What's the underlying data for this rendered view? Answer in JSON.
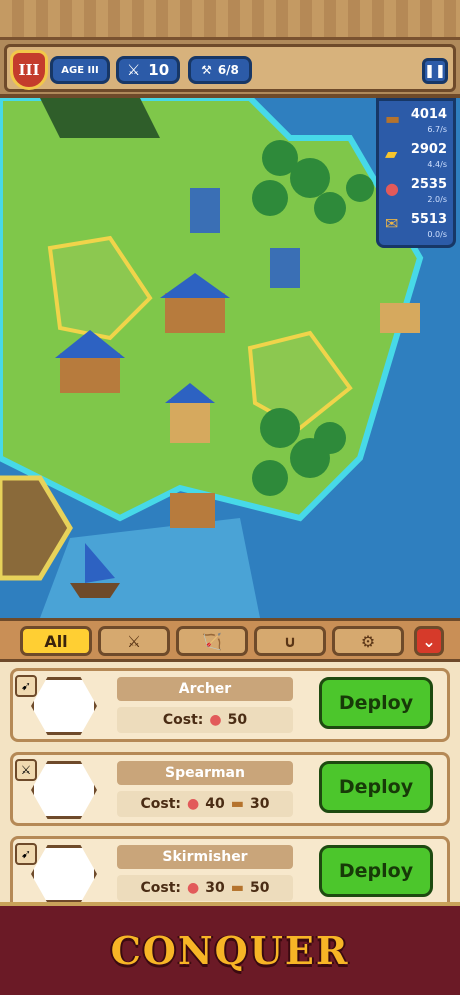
{
  "topbar": {
    "age_roman": "III",
    "age_label": "AGE III",
    "sword_count": "10",
    "workers": "6/8"
  },
  "resources": [
    {
      "icon": "wood-icon",
      "value": "4014",
      "rate": "6.7/s"
    },
    {
      "icon": "gold-icon",
      "value": "2902",
      "rate": "4.4/s"
    },
    {
      "icon": "meat-icon",
      "value": "2535",
      "rate": "2.0/s"
    },
    {
      "icon": "scroll-icon",
      "value": "5513",
      "rate": "0.0/s"
    }
  ],
  "tabs": {
    "all_label": "All"
  },
  "units": [
    {
      "name": "Archer",
      "cost_label": "Cost:",
      "meat": "50",
      "wood": "",
      "deploy": "Deploy"
    },
    {
      "name": "Spearman",
      "cost_label": "Cost:",
      "meat": "40",
      "wood": "30",
      "deploy": "Deploy"
    },
    {
      "name": "Skirmisher",
      "cost_label": "Cost:",
      "meat": "30",
      "wood": "50",
      "deploy": "Deploy"
    }
  ],
  "banner": {
    "text": "CONQUER"
  },
  "colors": {
    "primary_blue": "#2c5ba8",
    "deploy_green": "#4cc62c",
    "banner_red": "#6b1a26",
    "gold_text": "#f7b526"
  }
}
